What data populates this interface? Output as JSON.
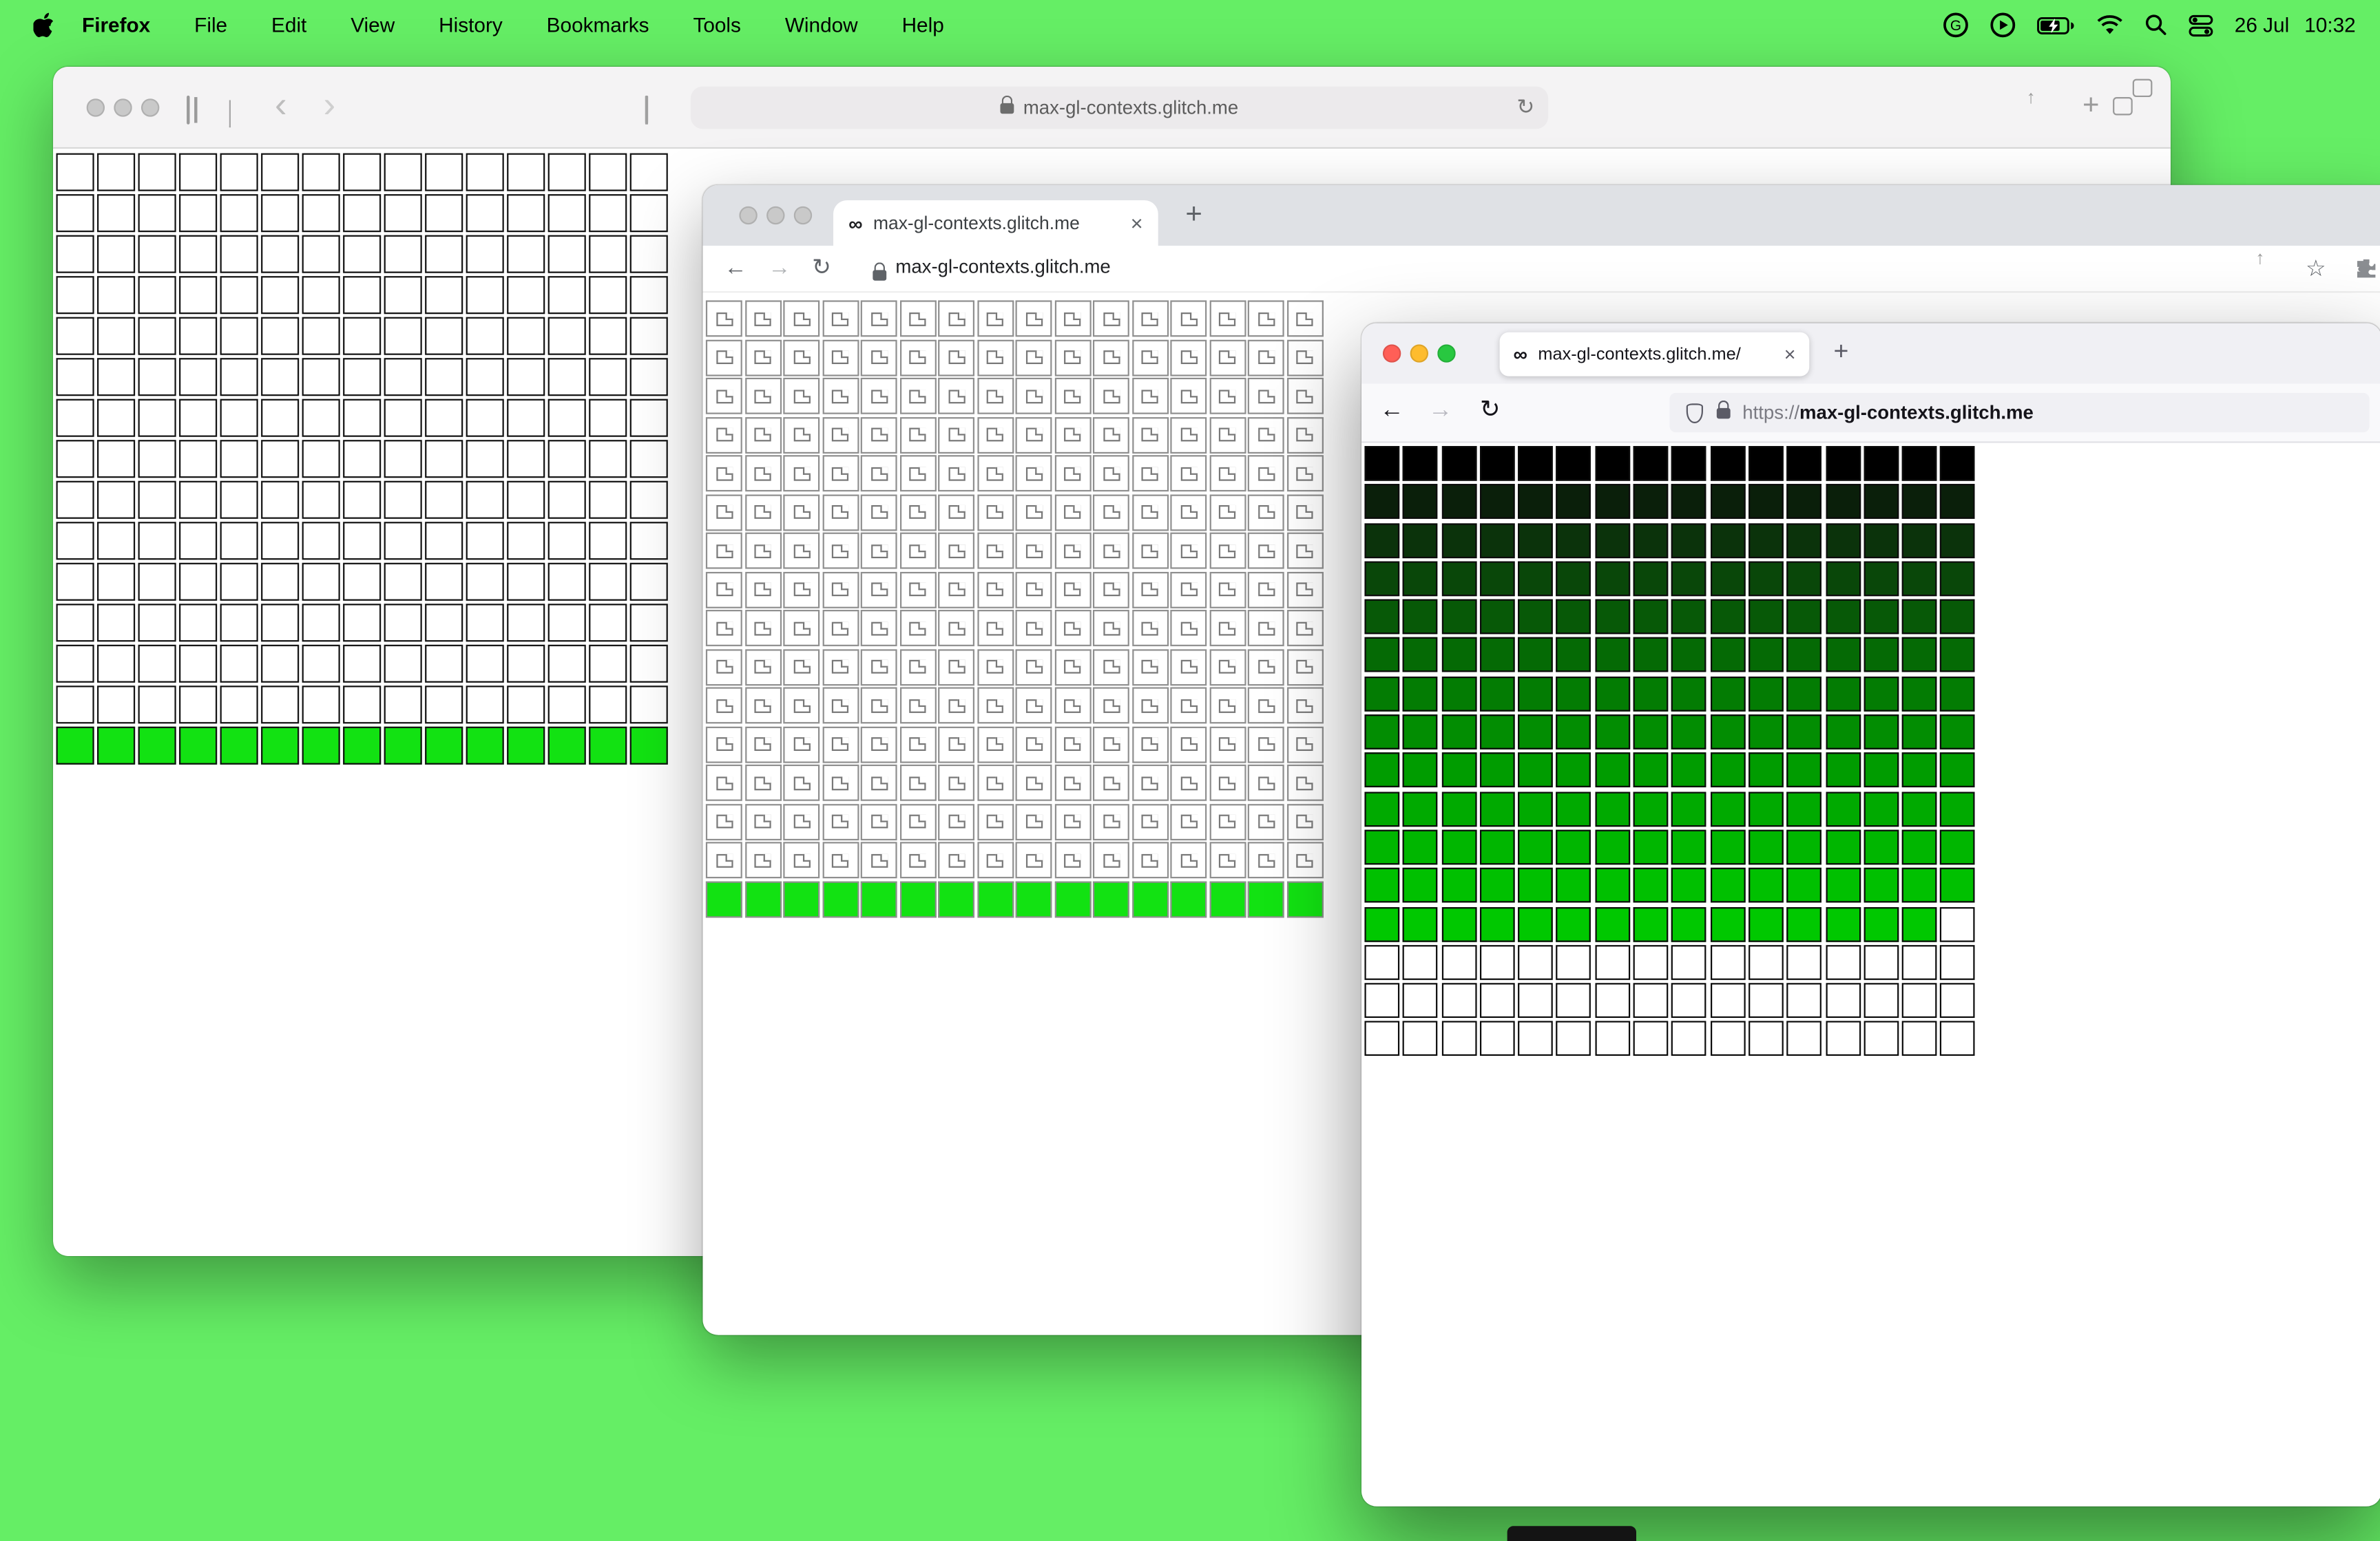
{
  "menu_bar": {
    "app_name": "Firefox",
    "items": [
      "File",
      "Edit",
      "View",
      "History",
      "Bookmarks",
      "Tools",
      "Window",
      "Help"
    ],
    "date": "26 Jul",
    "time": "10:32"
  },
  "glyphs": {
    "back_chevron": "‹",
    "forward_chevron": "›",
    "back_arrow": "←",
    "forward_arrow": "→",
    "reload": "↻",
    "plus": "+",
    "close": "×",
    "star": "☆",
    "infinity": "∞",
    "up_arrow": "↑"
  },
  "colors": {
    "desktop_green": "#65ee65",
    "bright_row_green": "#12e212",
    "firefox_full_green": "#00c800",
    "black_cell": "#000000"
  },
  "windows": {
    "safari": {
      "url": "max-gl-contexts.glitch.me",
      "grid": {
        "cols": 15,
        "rows": [
          {
            "repeat": 14,
            "color": "#ffffff"
          },
          {
            "color": "#12e212"
          }
        ]
      }
    },
    "chrome": {
      "tab_title": "max-gl-contexts.glitch.me",
      "url": "max-gl-contexts.glitch.me",
      "grid": {
        "cols": 16,
        "rows": [
          {
            "repeat": 15,
            "color": "#ffffff",
            "icon": true
          },
          {
            "color": "#12e212"
          }
        ]
      }
    },
    "firefox": {
      "tab_title": "max-gl-contexts.glitch.me/",
      "url_scheme": "https://",
      "url_host": "max-gl-contexts.glitch.me",
      "grid": {
        "cols": 16,
        "rows": [
          {
            "color": "#000000"
          },
          {
            "color": "#0a1f0a"
          },
          {
            "color": "#0b330b"
          },
          {
            "color": "#094709"
          },
          {
            "color": "#075907"
          },
          {
            "color": "#056a05"
          },
          {
            "color": "#037c03"
          },
          {
            "color": "#028d02"
          },
          {
            "color": "#009c00"
          },
          {
            "color": "#00aa00"
          },
          {
            "color": "#00b600"
          },
          {
            "color": "#00c000"
          },
          {
            "color": "#00c800",
            "last": "#ffffff"
          },
          {
            "repeat": 3,
            "color": "#ffffff"
          }
        ]
      }
    }
  }
}
